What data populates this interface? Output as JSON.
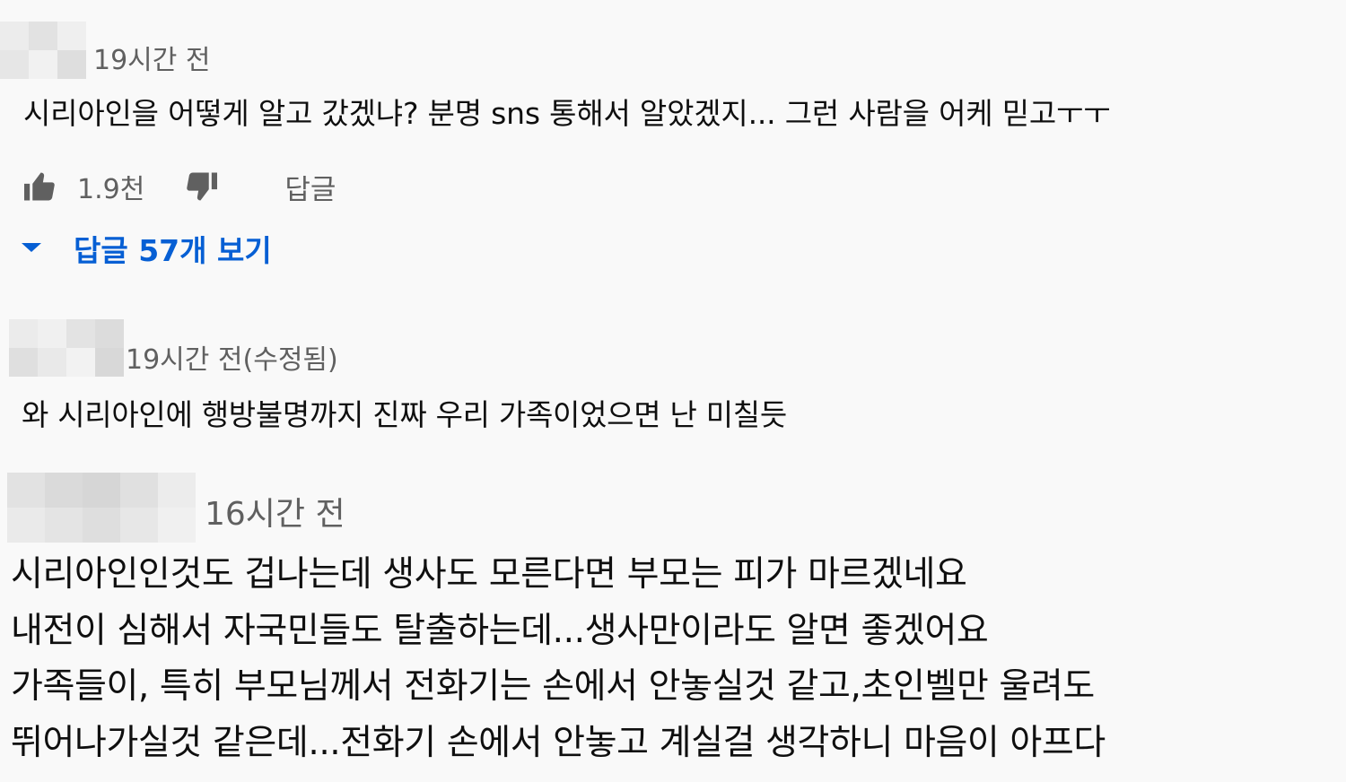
{
  "comments": [
    {
      "timestamp": "19시간 전",
      "text": "시리아인을 어떻게 알고 갔겠냐? 분명 sns 통해서 알았겠지... 그런 사람을 어케 믿고ㅜㅜ",
      "likes": "1.9천",
      "reply_label": "답글",
      "view_replies_label": "답글 57개 보기"
    },
    {
      "timestamp": "19시간 전(수정됨)",
      "text": "와 시리아인에 행방불명까지 진짜 우리 가족이었으면 난 미칠듯"
    },
    {
      "timestamp": "16시간 전",
      "lines": [
        "시리아인인것도 겁나는데 생사도 모른다면 부모는 피가 마르겠네요",
        "내전이 심해서 자국민들도 탈출하는데...생사만이라도 알면 좋겠어요",
        "가족들이, 특히 부모님께서 전화기는 손에서 안놓실것 같고,초인벨만 울려도",
        "뛰어나가실것 같은데...전화기 손에서 안놓고 계실걸 생각하니 마음이  아프다"
      ]
    }
  ],
  "colors": {
    "background": "#f9f9f9",
    "text": "#0f0f0f",
    "meta": "#606060",
    "link": "#065fd4"
  },
  "icons": {
    "like": "thumbs-up-icon",
    "dislike": "thumbs-down-icon",
    "expand": "caret-down-icon"
  }
}
